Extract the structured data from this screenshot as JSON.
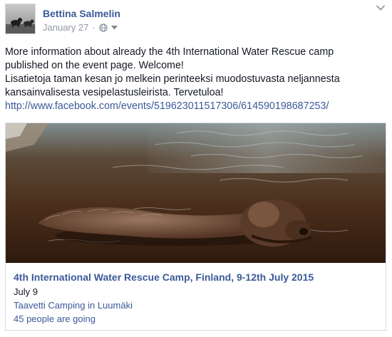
{
  "post": {
    "author": "Bettina Salmelin",
    "date": "January 27",
    "separator": "·",
    "text_lines": [
      "More information about already the 4th International Water Rescue camp",
      "published on the event page. Welcome!",
      "Lisatietoja taman kesan jo melkein perinteeksi muodostuvasta neljannesta",
      "kansainvalisesta vesipelastusleirista. Tervetuloa!"
    ],
    "link": "http://www.facebook.com/events/519623011517306/614590198687253/"
  },
  "event": {
    "title": "4th International Water Rescue Camp, Finland, 9-12th July 2015",
    "date": "July 9",
    "place": "Taavetti Camping",
    "in_word": "in",
    "town": "Luumäki",
    "going": "45 people are going"
  },
  "icons": {
    "privacy": "globe-icon",
    "audience_menu": "caret-down-icon",
    "post_options": "chevron-down-icon"
  },
  "colors": {
    "link_blue": "#3b5998",
    "meta_gray": "#9197a3",
    "text": "#141823",
    "water_dark": "#3a2414",
    "water_light": "#8fa0a6",
    "dog_fur": "#6b4a38"
  }
}
